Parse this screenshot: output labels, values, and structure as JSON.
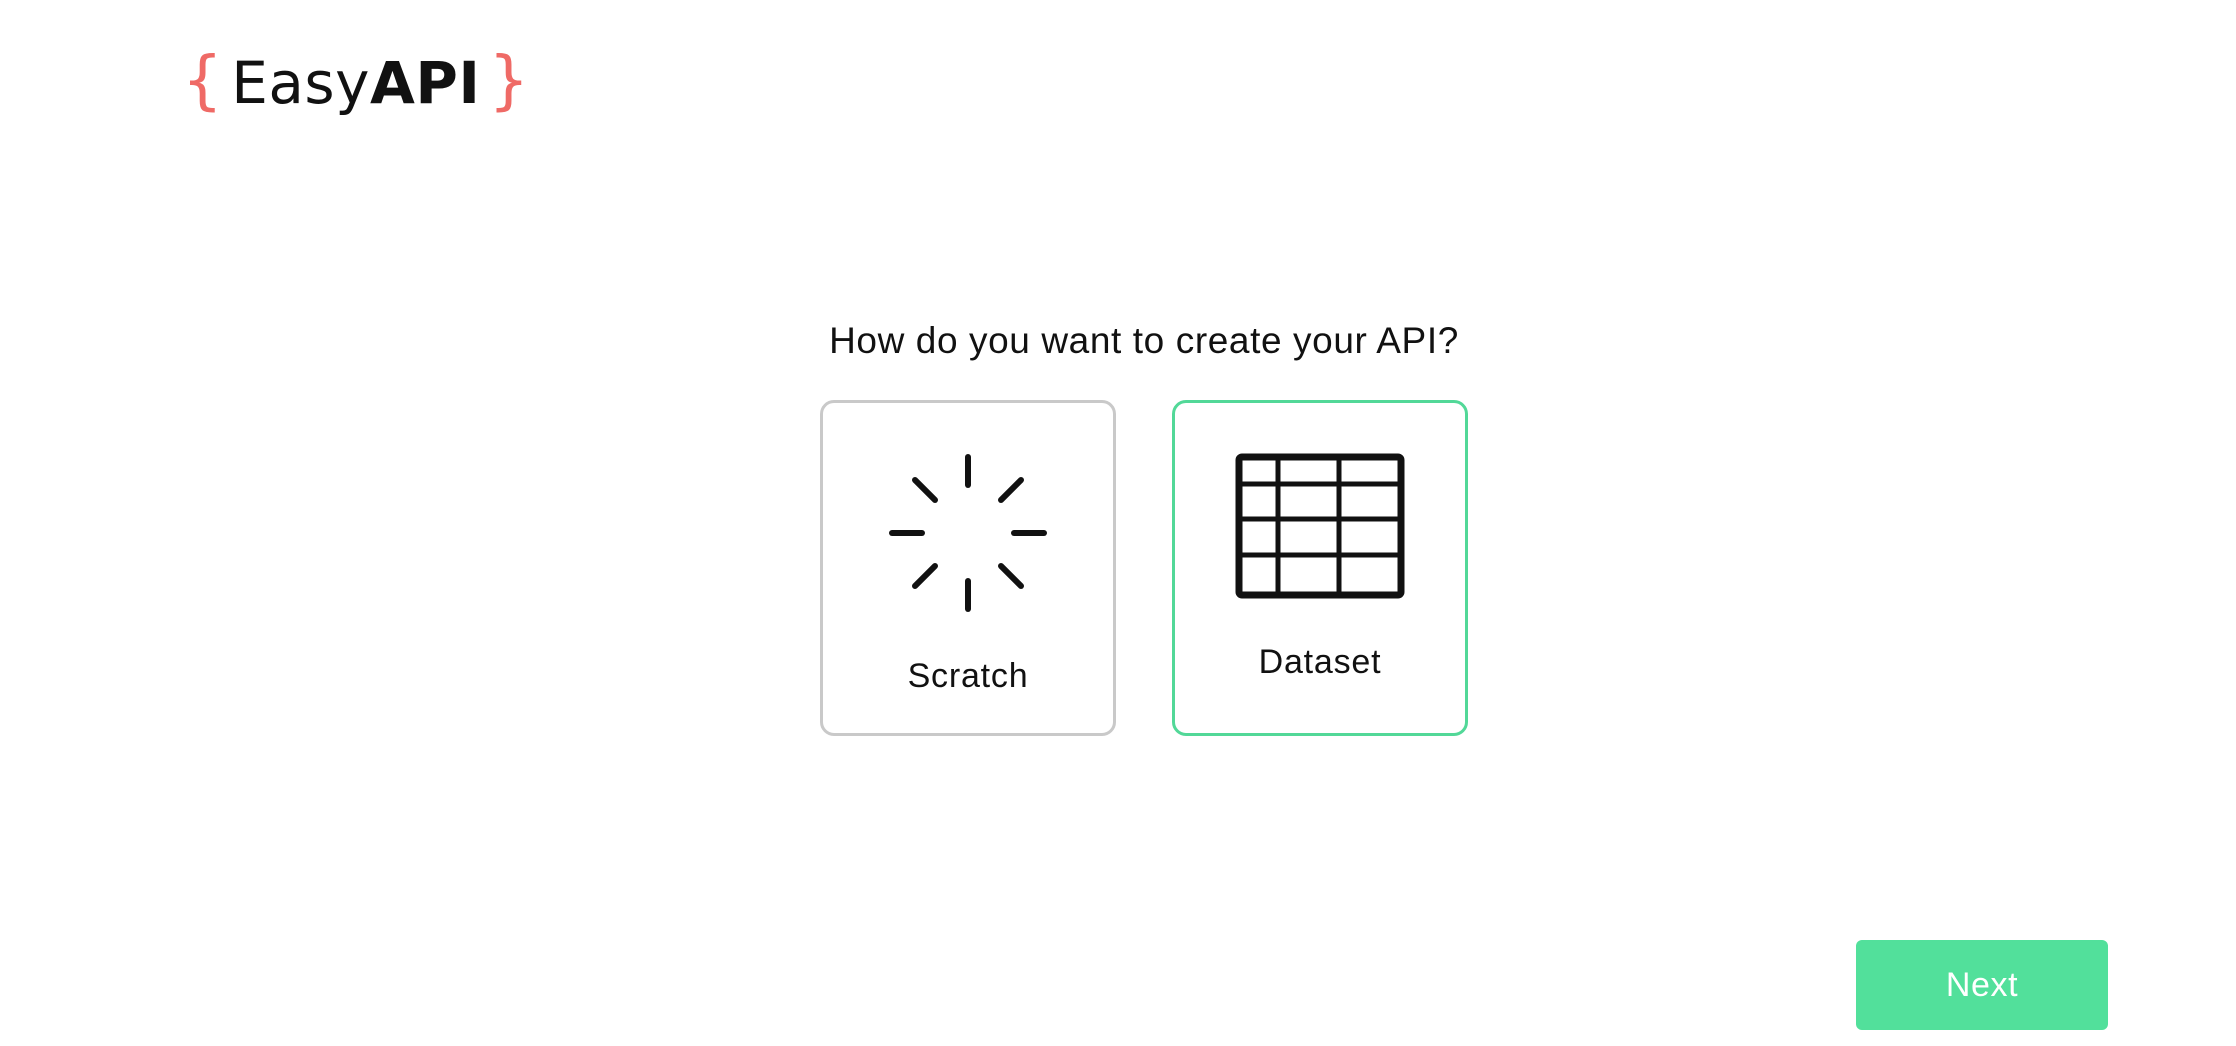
{
  "logo": {
    "brace_open": "{",
    "text_regular": "Easy",
    "text_bold": "API",
    "brace_close": "}",
    "brace_color": "#ef6a66"
  },
  "question": "How do you want to create your API?",
  "options": [
    {
      "label": "Scratch",
      "icon": "loading-burst-icon",
      "selected": false
    },
    {
      "label": "Dataset",
      "icon": "table-grid-icon",
      "selected": true
    }
  ],
  "next_button": {
    "label": "Next",
    "color": "#52e09b"
  },
  "colors": {
    "selected_border": "#52d898",
    "unselected_border": "#c9c9c9"
  }
}
